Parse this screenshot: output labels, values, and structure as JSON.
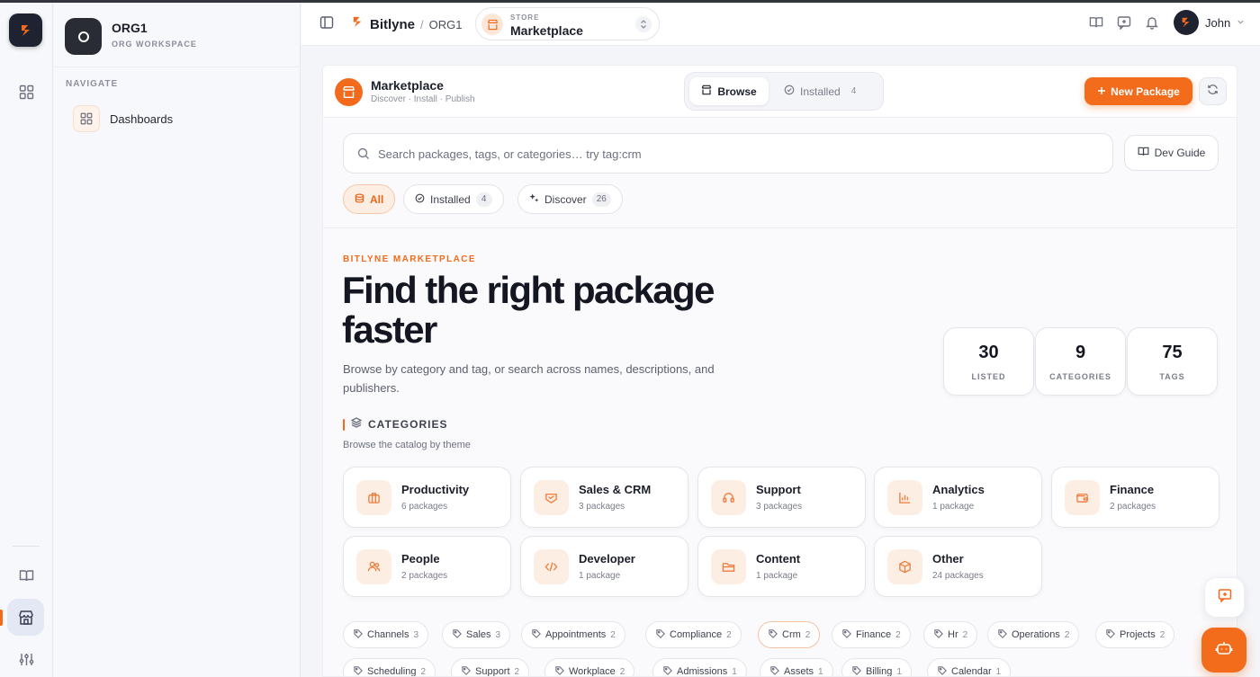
{
  "org": {
    "name": "ORG1",
    "subtitle": "ORG WORKSPACE"
  },
  "nav": {
    "label": "NAVIGATE",
    "items": [
      {
        "label": "Dashboards",
        "icon": "grid-icon"
      }
    ]
  },
  "topbar": {
    "brand": "Bitlyne",
    "separator": "/",
    "org": "ORG1",
    "store_label": "STORE",
    "store_value": "Marketplace",
    "user_name": "John"
  },
  "page": {
    "title": "Marketplace",
    "subtitle": "Discover · Install · Publish",
    "tabs": [
      {
        "label": "Browse"
      },
      {
        "label": "Installed",
        "count": "4"
      }
    ],
    "new_button": "New Package"
  },
  "search": {
    "placeholder": "Search packages, tags, or categories… try tag:crm",
    "value": ""
  },
  "dev_guide": "Dev Guide",
  "filters": [
    {
      "label": "All"
    },
    {
      "label": "Installed",
      "count": "4"
    },
    {
      "label": "Discover",
      "count": "26"
    }
  ],
  "hero": {
    "eyebrow": "BITLYNE MARKETPLACE",
    "title": "Find the right package faster",
    "subtitle": "Browse by category and tag, or search across names, descriptions, and publishers."
  },
  "stats": [
    {
      "value": "30",
      "label": "LISTED"
    },
    {
      "value": "9",
      "label": "CATEGORIES"
    },
    {
      "value": "75",
      "label": "TAGS"
    }
  ],
  "categories": {
    "title": "CATEGORIES",
    "subtitle": "Browse the catalog by theme",
    "items": [
      {
        "name": "Productivity",
        "count": "6 packages",
        "icon": "briefcase-icon"
      },
      {
        "name": "Sales & CRM",
        "count": "3 packages",
        "icon": "handshake-icon"
      },
      {
        "name": "Support",
        "count": "3 packages",
        "icon": "headset-icon"
      },
      {
        "name": "Analytics",
        "count": "1 package",
        "icon": "bar-chart-icon"
      },
      {
        "name": "Finance",
        "count": "2 packages",
        "icon": "wallet-icon"
      },
      {
        "name": "People",
        "count": "2 packages",
        "icon": "users-icon"
      },
      {
        "name": "Developer",
        "count": "1 package",
        "icon": "code-icon"
      },
      {
        "name": "Content",
        "count": "1 package",
        "icon": "folder-icon"
      },
      {
        "name": "Other",
        "count": "24 packages",
        "icon": "box-icon"
      }
    ]
  },
  "tags_row1": [
    {
      "name": "Channels",
      "count": "3"
    },
    {
      "name": "Sales",
      "count": "3"
    },
    {
      "name": "Appointments",
      "count": "2"
    },
    {
      "name": "Compliance",
      "count": "2"
    },
    {
      "name": "Crm",
      "count": "2"
    },
    {
      "name": "Finance",
      "count": "2"
    },
    {
      "name": "Hr",
      "count": "2"
    },
    {
      "name": "Operations",
      "count": "2"
    },
    {
      "name": "Projects",
      "count": "2"
    }
  ],
  "tags_row2": [
    {
      "name": "Scheduling",
      "count": "2"
    },
    {
      "name": "Support",
      "count": "2"
    },
    {
      "name": "Workplace",
      "count": "2"
    },
    {
      "name": "Admissions",
      "count": "1"
    },
    {
      "name": "Assets",
      "count": "1"
    },
    {
      "name": "Billing",
      "count": "1"
    },
    {
      "name": "Calendar",
      "count": "1"
    }
  ],
  "colors": {
    "accent": "#f36c1c",
    "accent_soft": "#fdeee4"
  }
}
